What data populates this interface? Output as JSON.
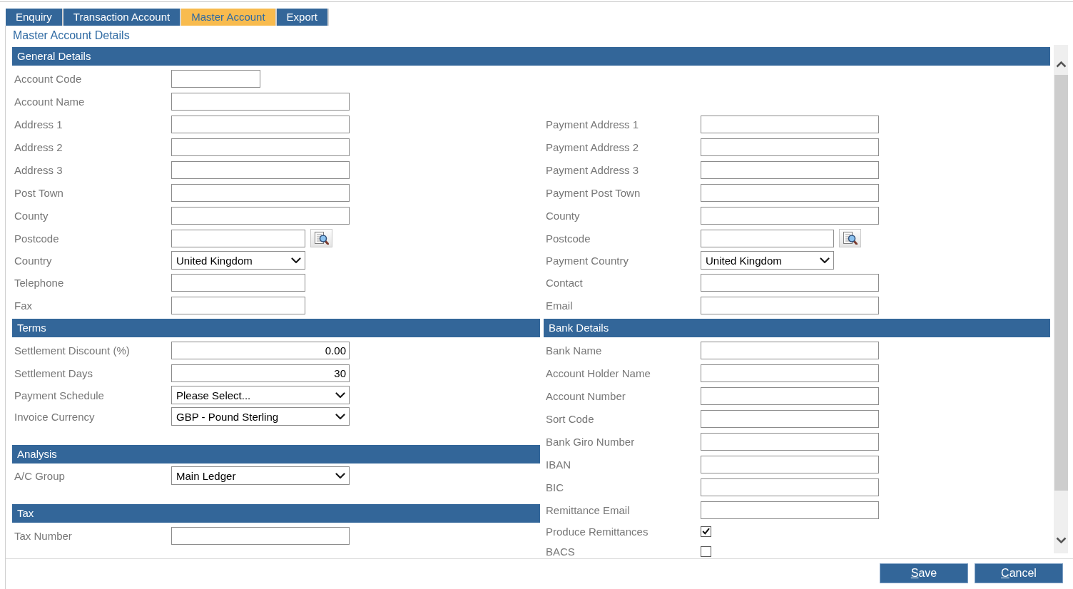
{
  "tabs": [
    {
      "label": "Enquiry",
      "selected": false
    },
    {
      "label": "Transaction Account",
      "selected": false
    },
    {
      "label": "Master Account",
      "selected": true
    },
    {
      "label": "Export",
      "selected": false
    }
  ],
  "page_title": "Master Account Details",
  "general_details": {
    "title": "General Details",
    "left_fields": [
      {
        "label": "Account Code",
        "kind": "text"
      },
      {
        "label": "Account Name",
        "kind": "text"
      },
      {
        "label": "Address 1",
        "kind": "text"
      },
      {
        "label": "Address 2",
        "kind": "text"
      },
      {
        "label": "Address 3",
        "kind": "text"
      },
      {
        "label": "Post Town",
        "kind": "text"
      },
      {
        "label": "County",
        "kind": "text"
      },
      {
        "label": "Postcode",
        "kind": "lookup"
      },
      {
        "label": "Country",
        "kind": "select",
        "value": "United Kingdom"
      },
      {
        "label": "Telephone",
        "kind": "text"
      },
      {
        "label": "Fax",
        "kind": "text"
      }
    ],
    "right_fields": [
      {
        "label": "Payment Address 1",
        "kind": "text"
      },
      {
        "label": "Payment Address 2",
        "kind": "text"
      },
      {
        "label": "Payment Address 3",
        "kind": "text"
      },
      {
        "label": "Payment Post Town",
        "kind": "text"
      },
      {
        "label": "County",
        "kind": "text"
      },
      {
        "label": "Postcode",
        "kind": "lookup"
      },
      {
        "label": "Payment Country",
        "kind": "select",
        "value": "United Kingdom"
      },
      {
        "label": "Contact",
        "kind": "text"
      },
      {
        "label": "Email",
        "kind": "text"
      }
    ]
  },
  "terms": {
    "title": "Terms",
    "fields": [
      {
        "label": "Settlement Discount (%)",
        "kind": "number",
        "value": "0.00"
      },
      {
        "label": "Settlement Days",
        "kind": "number",
        "value": "30"
      },
      {
        "label": "Payment Schedule",
        "kind": "select",
        "value": "Please Select..."
      },
      {
        "label": "Invoice Currency",
        "kind": "select",
        "value": "GBP - Pound Sterling"
      }
    ]
  },
  "analysis": {
    "title": "Analysis",
    "fields": [
      {
        "label": "A/C Group",
        "kind": "select",
        "value": "Main Ledger"
      }
    ]
  },
  "tax": {
    "title": "Tax",
    "fields": [
      {
        "label": "Tax Number",
        "kind": "text"
      }
    ]
  },
  "bank_details": {
    "title": "Bank Details",
    "fields": [
      {
        "label": "Bank Name",
        "kind": "text"
      },
      {
        "label": "Account Holder Name",
        "kind": "text"
      },
      {
        "label": "Account Number",
        "kind": "text"
      },
      {
        "label": "Sort Code",
        "kind": "text"
      },
      {
        "label": "Bank Giro Number",
        "kind": "text"
      },
      {
        "label": "IBAN",
        "kind": "text"
      },
      {
        "label": "BIC",
        "kind": "text"
      },
      {
        "label": "Remittance Email",
        "kind": "text"
      },
      {
        "label": "Produce Remittances",
        "kind": "checkbox",
        "checked": true
      },
      {
        "label": "BACS",
        "kind": "checkbox",
        "checked": false
      }
    ]
  },
  "buttons": [
    {
      "label": "Save"
    },
    {
      "label": "Cancel"
    }
  ]
}
